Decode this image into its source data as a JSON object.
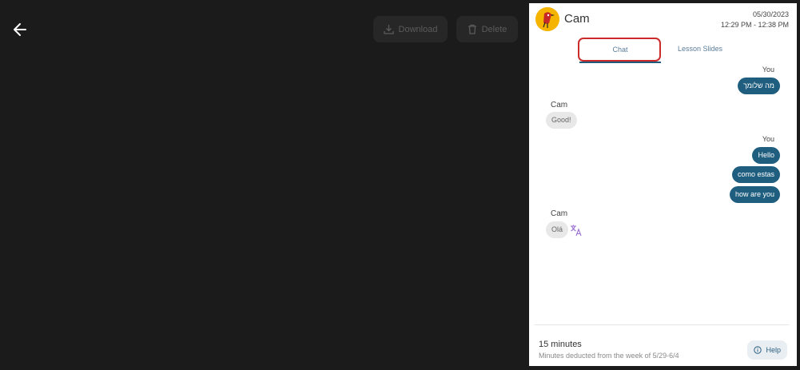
{
  "toolbar": {
    "download_label": "Download",
    "delete_label": "Delete"
  },
  "header": {
    "tutor_name": "Cam",
    "date": "05/30/2023",
    "time_range": "12:29 PM - 12:38 PM"
  },
  "tabs": [
    {
      "label": "Chat",
      "active": true
    },
    {
      "label": "Lesson Slides",
      "active": false
    }
  ],
  "chat": {
    "you_label": "You",
    "cam_label": "Cam",
    "messages": [
      {
        "from": "You",
        "text": "מה שלומך"
      },
      {
        "from": "Cam",
        "text": "Good!"
      },
      {
        "from": "You",
        "text": "Hello"
      },
      {
        "from": "You",
        "text": "como estas"
      },
      {
        "from": "You",
        "text": "how are you"
      },
      {
        "from": "Cam",
        "text": "Olá"
      }
    ]
  },
  "footer": {
    "minutes": "15 minutes",
    "minutes_note": "Minutes deducted from the week of 5/29-6/4",
    "help_label": "Help"
  },
  "colors": {
    "viewer_bg": "#1b1b1b",
    "my_bubble": "#1f5e7e",
    "their_bubble": "#e8e8e8",
    "active_tab_outline": "#cc2b2b",
    "translate_icon": "#9b6fd1"
  },
  "icons": [
    "arrow-left-icon",
    "download-icon",
    "trash-icon",
    "translate-icon",
    "info-icon"
  ]
}
